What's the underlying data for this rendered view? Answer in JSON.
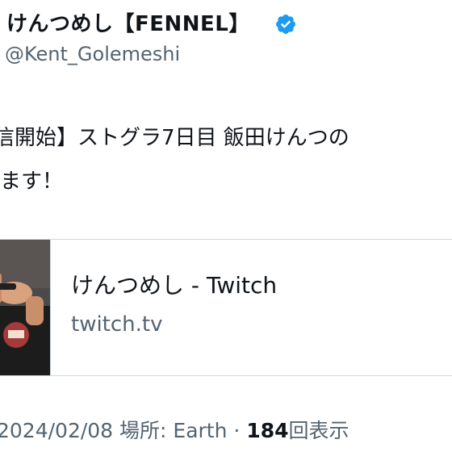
{
  "header": {
    "display_name": "けんつめし【FENNEL】",
    "handle": "@Kent_Golemeshi",
    "verified_icon": "verified-badge-icon",
    "verified_color": "#1d9bf0"
  },
  "tweet": {
    "line1": "信開始】ストグラ7日目 飯田けんつの",
    "line2": "ます！"
  },
  "card": {
    "title": "けんつめし - Twitch",
    "domain": "twitch.tv",
    "thumbnail": "stream-thumbnail"
  },
  "meta": {
    "date": "2024/02/08",
    "location_label": "場所: Earth",
    "separator": "·",
    "view_count": "184",
    "view_label": "回表示"
  },
  "colors": {
    "text_primary": "#0f1419",
    "text_secondary": "#536471",
    "border": "#cfd9de"
  }
}
